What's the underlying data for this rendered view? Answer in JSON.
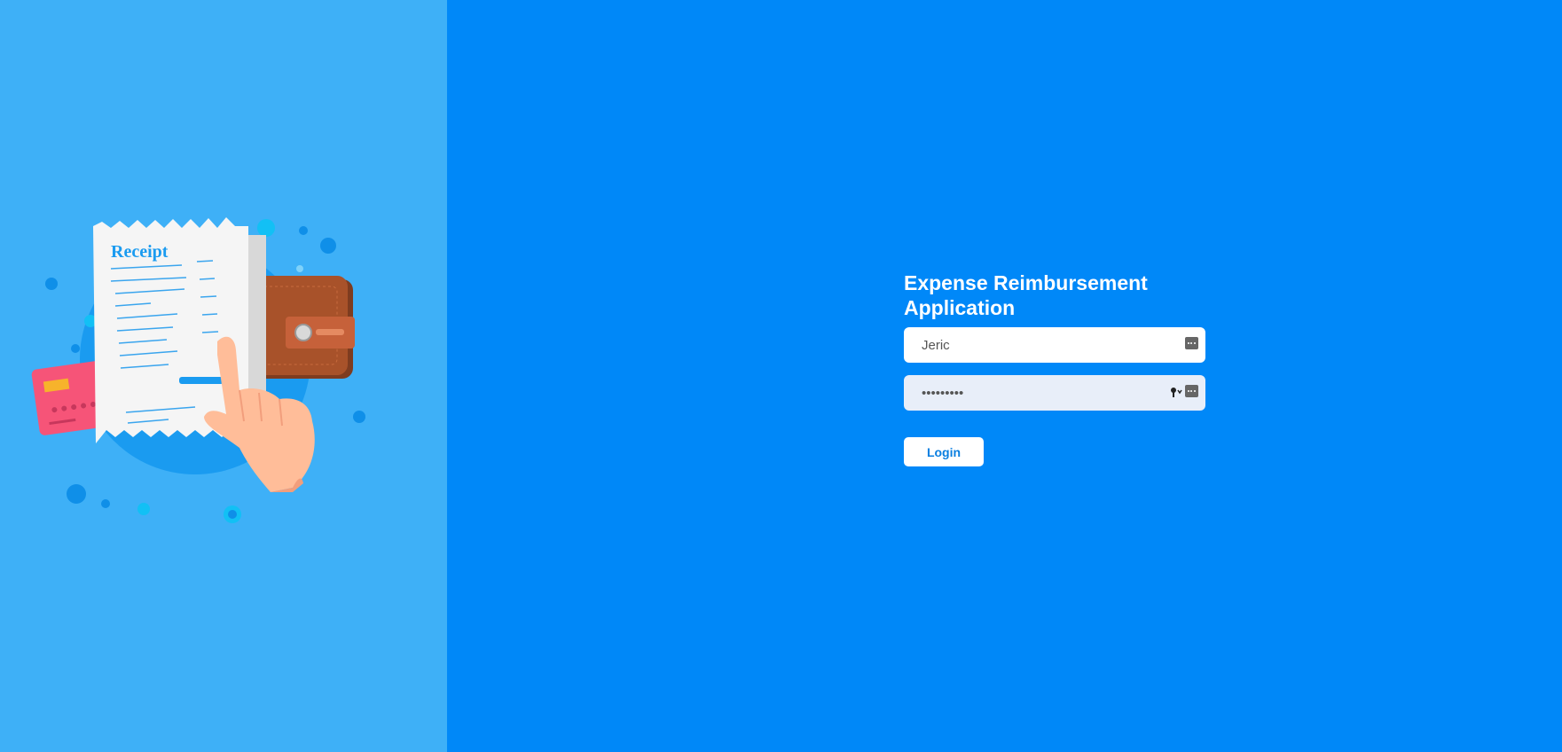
{
  "app": {
    "title": "Expense Reimbursement Application"
  },
  "illustration": {
    "receipt_heading": "Receipt"
  },
  "form": {
    "username_value": "Jeric",
    "password_value": "•••••••••",
    "login_label": "Login"
  },
  "colors": {
    "left_panel": "#3eb0f7",
    "right_panel": "#0088f8",
    "button_text": "#0a7fe0"
  }
}
